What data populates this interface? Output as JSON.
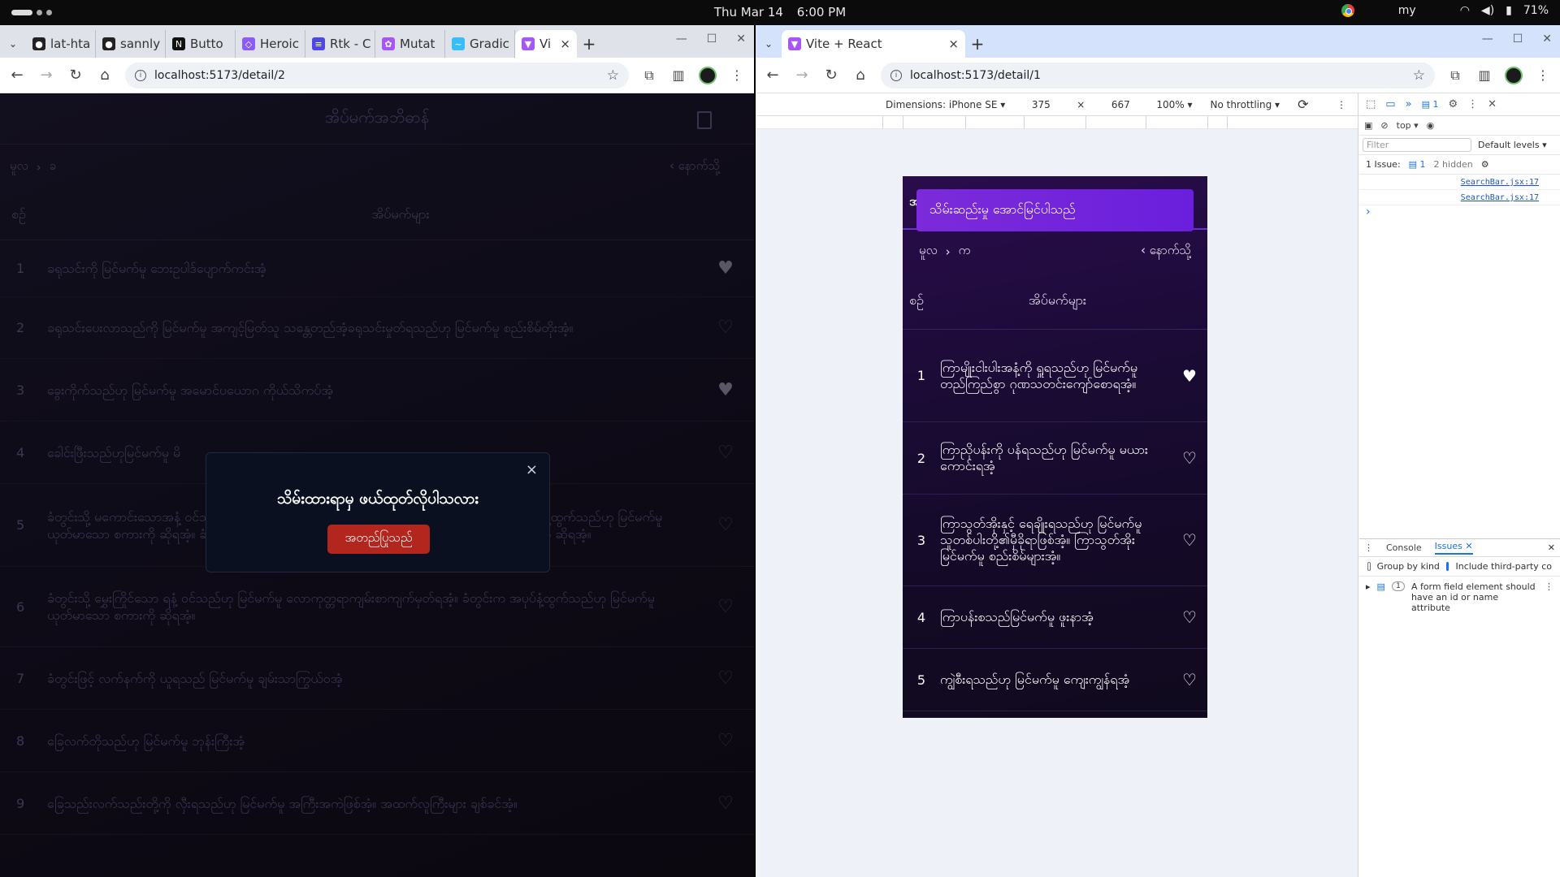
{
  "system": {
    "date": "Thu Mar 14",
    "time": "6:00 PM",
    "keyboard": "my",
    "battery": "71%"
  },
  "left": {
    "tabs": [
      {
        "label": "lat-hta",
        "icon": "github-icon",
        "color": "#222"
      },
      {
        "label": "sannly",
        "icon": "github-icon",
        "color": "#222"
      },
      {
        "label": "Butto",
        "icon": "nextjs-icon",
        "color": "#111"
      },
      {
        "label": "Heroic",
        "icon": "heroicons-icon",
        "color": "#8b5cf6"
      },
      {
        "label": "Rtk - C",
        "icon": "docs-icon",
        "color": "#4f46e5"
      },
      {
        "label": "Mutat",
        "icon": "tanstack-icon",
        "color": "#a855f7"
      },
      {
        "label": "Gradic",
        "icon": "tailwind-icon",
        "color": "#38bdf8"
      },
      {
        "label": "Vi",
        "icon": "vite-icon",
        "color": "#a855f7"
      }
    ],
    "url": "localhost:5173/detail/2",
    "page": {
      "title": "အိပ်မက်အဘိဓာန်",
      "crumb_home": "မူလ",
      "crumb_sep": "›",
      "crumb_current": "ခ",
      "back": "‹ နောက်သို့",
      "col_no": "စဉ်",
      "col_title": "အိပ်မက်များ",
      "rows": [
        {
          "no": "1",
          "text": "ခရုသင်းကို မြင်မက်မူ ဘေးဥပါဒ်ပျောက်ကင်းအံ့",
          "fav": true
        },
        {
          "no": "2",
          "text": "ခရုသင်းပေးလာသည်ကို မြင်မက်မူ အကျင့်မြတ်သူ သန္တေတည်အံ့ခရုသင်းမှုတ်ရသည်ဟု မြင်မက်မူ စည်းစိမ်တိုးအံ့။",
          "fav": false
        },
        {
          "no": "3",
          "text": "ခွေးကိုက်သည်ဟု မြင်မက်မူ အမောင်ပယောဂ ကိုယ်သိကပ်အံ့",
          "fav": true
        },
        {
          "no": "4",
          "text": "ခေါင်းဖြီးသည်ဟုမြင်မက်မူ မိ",
          "fav": false
        },
        {
          "no": "5",
          "text": "ခံတွင်းသို့ မကောင်းသောအနံ့ ဝင်သည်ဟု မြင်မက်မူ လောကုတ္တရာကျမ်းစာ ကျက်မှတ်ရအံ့။ ခံတွင်းက အပုပ်နံ့ထွက်သည်ဟု မြင်မက်မူယုတ်မာသော စကားကို ဆိုရအံ့။ ခံတွင်းက ကောင်းသောအနံ့ ထွက်သည်ဟု မြင်မက်မူ ကောင်းသော စကားကို ဆိုရအံ့။",
          "fav": false
        },
        {
          "no": "6",
          "text": "ခံတွင်းသို့ မွှေးကြိုင်သော ရနံ့ ဝင်သည်ဟု မြင်မက်မူ လောကုတ္တရာကျမ်းစာကျက်မှတ်ရအံ့။ ခံတွင်းက အပုပ်နံ့ထွက်သည်ဟု မြင်မက်မူယုတ်မာသော စကားကို ဆိုရအံ့။",
          "fav": false
        },
        {
          "no": "7",
          "text": "ခံတွင်းဖြင့် လက်နက်ကို ယူရသည် မြင်မက်မူ ချမ်းသာကြွယ်ဝအံ့",
          "fav": false
        },
        {
          "no": "8",
          "text": "ခြေလက်တိုသည်ဟု မြင်မက်မူ ဘုန်းကြီးအံ့",
          "fav": false
        },
        {
          "no": "9",
          "text": "ခြေသည်းလက်သည်းတို့ကို လှီးရသည်ဟု မြင်မက်မူ အကြီးအကဲဖြစ်အံ့။ အထက်လူကြီးများ ချစ်ခင်အံ့။",
          "fav": false
        }
      ]
    },
    "modal": {
      "message": "သိမ်းထားရာမှ ဖယ်ထုတ်လိုပါသလား",
      "confirm": "အတည်ပြုသည်",
      "close": "×"
    }
  },
  "right": {
    "tab_title": "Vite + React",
    "url": "localhost:5173/detail/1",
    "device": {
      "dimensions": "Dimensions: iPhone SE ▾",
      "width": "375",
      "times": "×",
      "height": "667",
      "zoom": "100% ▾",
      "throttle": "No throttling ▾"
    },
    "phone": {
      "toast": "သိမ်းဆည်းမှု အောင်မြင်ပါသည်",
      "title_peek": "အ",
      "crumb_home": "မူလ",
      "crumb_sep": "›",
      "crumb_current": "က",
      "back": "‹ နောက်သို့",
      "col_no": "စဉ်",
      "col_title": "အိပ်မက်များ",
      "rows": [
        {
          "no": "1",
          "text": "ကြာမျိုးငါးပါးအနံ့ကို ရှူရသည်ဟု မြင်မက်မူ တည်ကြည်စွာ ဂုဏသတင်းကျော်စောရအံ့။",
          "fav": true
        },
        {
          "no": "2",
          "text": "ကြာညိုပန်းကို ပန်ရသည်ဟု မြင်မက်မူ မယားကောင်းရအံ့",
          "fav": false
        },
        {
          "no": "3",
          "text": "ကြာသွတ်အိုးနှင့် ရေချိုးရသည်ဟု မြင်မက်မူ သူတစ်ပါးတို့၏မှီခိုရာဖြစ်အံ့။ ကြာသွတ်အိုးမြင်မက်မူ စည်းစိမ်များအံ့။",
          "fav": false
        },
        {
          "no": "4",
          "text": "ကြာပန်းစသည်မြင်မက်မူ ဖူးနာအံ့",
          "fav": false
        },
        {
          "no": "5",
          "text": "ကျွဲစီးရသည်ဟု မြင်မက်မူ ကျေးကျွန်ရအံ့",
          "fav": false
        }
      ]
    },
    "devtools": {
      "issues_count": "1",
      "context": "top ▾",
      "filter_placeholder": "Filter",
      "levels": "Default levels ▾",
      "issue_label": "1 Issue:",
      "issue_num": "1",
      "hidden": "2 hidden",
      "links": [
        "SearchBar.jsx:17",
        "SearchBar.jsx:17"
      ],
      "caret": "›",
      "tab_console": "Console",
      "tab_issues": "Issues",
      "group_by_kind": "Group by kind",
      "include_third": "Include third-party co",
      "issue_count_badge": "1",
      "issue_text": "A form field element should have an id or name attribute"
    }
  }
}
